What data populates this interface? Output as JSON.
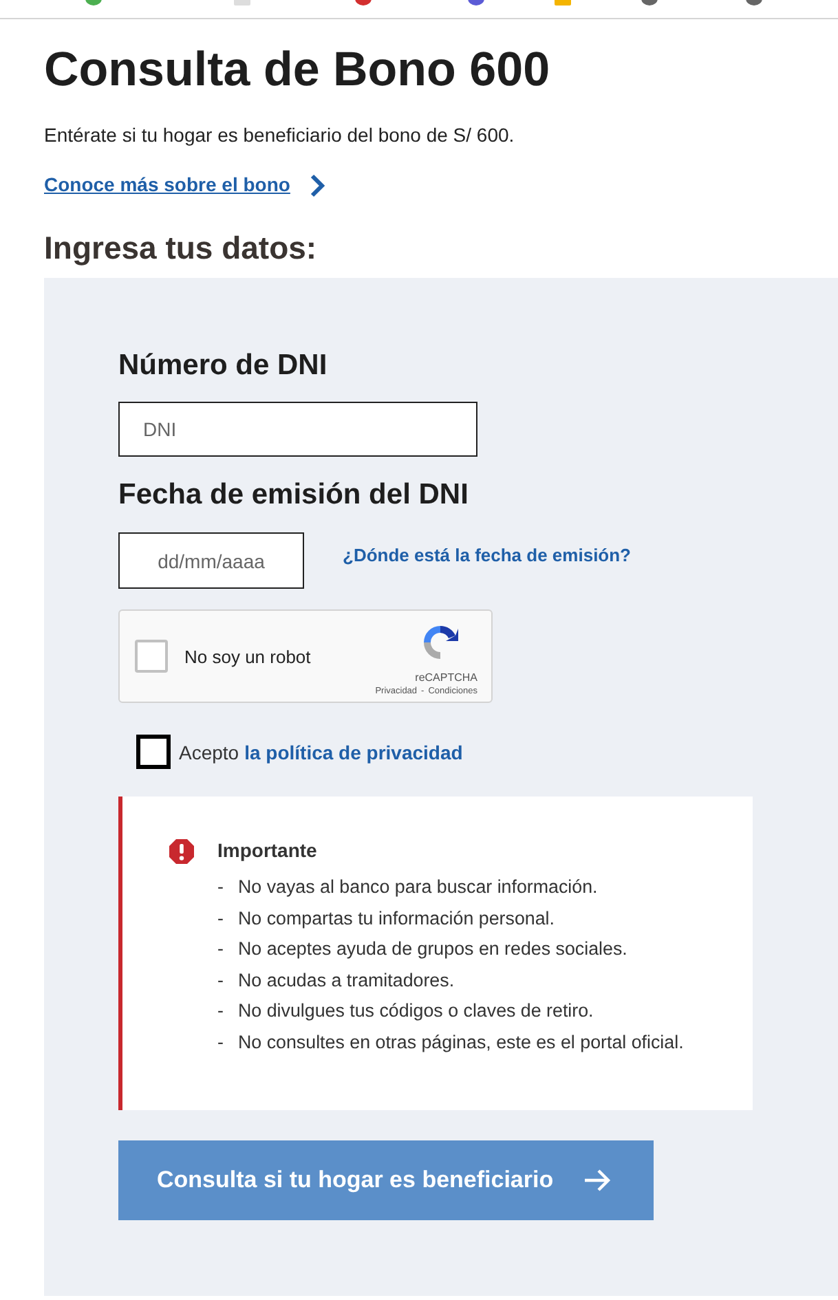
{
  "title": "Consulta de Bono 600",
  "subtitle": "Entérate si tu hogar es beneficiario del bono de S/ 600.",
  "more_link": "Conoce más sobre el bono",
  "form_heading": "Ingresa tus datos:",
  "dni": {
    "label": "Número de DNI",
    "placeholder": "DNI"
  },
  "issue_date": {
    "label": "Fecha de emisión del DNI",
    "placeholder": "dd/mm/aaaa",
    "help_link": "¿Dónde está la fecha de emisión?"
  },
  "captcha": {
    "label": "No soy un robot",
    "checked": false,
    "brand": "reCAPTCHA",
    "privacy": "Privacidad",
    "separator": "-",
    "terms": "Condiciones"
  },
  "privacy_consent": {
    "checked": false,
    "prefix": "Acepto",
    "link": "la política de privacidad"
  },
  "notice": {
    "title": "Importante",
    "items": [
      {
        "marker": "-",
        "text": "No vayas al banco para buscar información."
      },
      {
        "marker": "-",
        "text": "No compartas tu información personal."
      },
      {
        "marker": "-",
        "text": "No aceptes ayuda de grupos en redes sociales."
      },
      {
        "marker": "-",
        "text": "No acudas a tramitadores."
      },
      {
        "marker": "-",
        "text": "No divulgues tus códigos o claves de retiro."
      },
      {
        "marker": "-",
        "text": "No consultes en otras páginas, este es el portal oficial."
      }
    ]
  },
  "submit": "Consulta si tu hogar es beneficiario"
}
